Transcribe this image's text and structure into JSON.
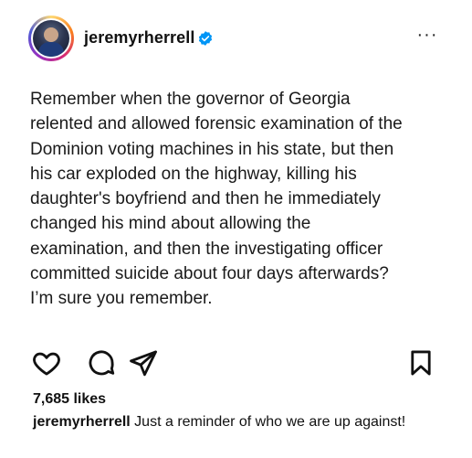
{
  "post": {
    "username": "jeremyrherrell",
    "verified": true,
    "avatar_icon": "profile-photo",
    "more_icon": "more-horizontal-icon",
    "more_label": "···",
    "text_lines": [
      "Remember when the governor of Georgia",
      "relented and allowed forensic examination of the",
      "Dominion voting machines in his state, but then",
      "his car exploded on the highway, killing his",
      "daughter's boyfriend and then he immediately",
      "changed his mind about allowing the",
      "examination, and then the investigating officer",
      "committed suicide about four days afterwards?",
      "I’m sure you remember."
    ]
  },
  "actions": {
    "like_icon": "heart-outline-icon",
    "comment_icon": "comment-bubble-icon",
    "share_icon": "send-paper-plane-icon",
    "save_icon": "bookmark-outline-icon"
  },
  "footer": {
    "likes": "7,685 likes",
    "caption_username": "jeremyrherrell",
    "caption_text": " Just a reminder of who we are up against!"
  },
  "colors": {
    "text": "#111111",
    "verified_badge": "#0095f6"
  }
}
